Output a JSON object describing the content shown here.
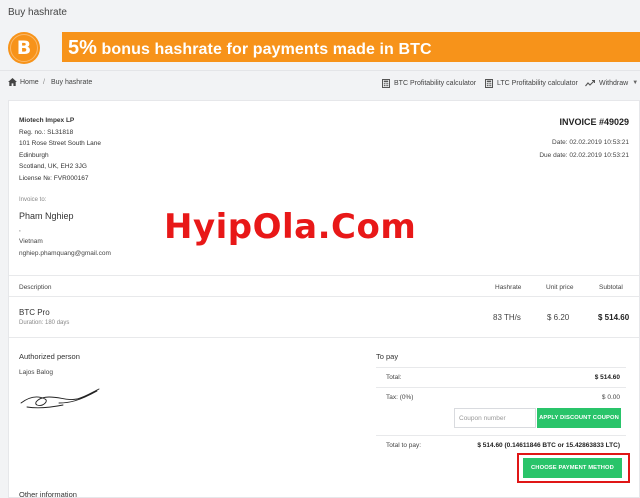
{
  "header": {
    "title": "Buy hashrate"
  },
  "banner": {
    "logo_symbol": "B",
    "percent": "5%",
    "text": " bonus hashrate for payments made in BTC",
    "color": "#f7931a"
  },
  "breadcrumb": {
    "home": "Home",
    "separator": "/",
    "current": "Buy hashrate"
  },
  "toolbar": {
    "btc_calc": "BTC Profitability calculator",
    "ltc_calc": "LTC Profitability calculator",
    "withdraw": "Withdraw"
  },
  "company": {
    "name": "Miotech Impex LP",
    "reg": "Reg. no.: SL31818",
    "street": "101 Rose Street South Lane",
    "city": "Edinburgh",
    "country": "Scotland, UK, EH2 3JG",
    "license": "License №: FVR000167"
  },
  "invoice": {
    "number": "INVOICE #49029",
    "date": "Date: 02.02.2019 10:53:21",
    "due_date": "Due date: 02.02.2019 10:53:21"
  },
  "client": {
    "label": "Invoice to:",
    "name": "Pham Nghiep",
    "line": ",",
    "country": "Vietnam",
    "email": "nghiep.phamquang@gmail.com"
  },
  "watermark": "HyipOla.Com",
  "table": {
    "headers": {
      "description": "Description",
      "hashrate": "Hashrate",
      "unit_price": "Unit price",
      "subtotal": "Subtotal"
    },
    "row": {
      "description": "BTC Pro",
      "duration": "Duration: 180 days",
      "hashrate": "83 TH/s",
      "unit_price": "$ 6.20",
      "subtotal": "$ 514.60"
    }
  },
  "authorized": {
    "label": "Authorized person",
    "name": "Lajos Balog"
  },
  "payment": {
    "label": "To pay",
    "total_label": "Total:",
    "total_value": "$ 514.60",
    "tax_label": "Tax: (0%)",
    "tax_value": "$ 0.00",
    "coupon_placeholder": "Coupon number",
    "apply_button": "APPLY DISCOUNT COUPON",
    "to_pay_label": "Total to pay:",
    "to_pay_value": "$ 514.60 (0.14611846 BTC or 15.42863833 LTC)",
    "choose_button": "CHOOSE PAYMENT METHOD",
    "button_color": "#29c46a",
    "highlight_color": "#e01616"
  },
  "other_info": "Other information"
}
